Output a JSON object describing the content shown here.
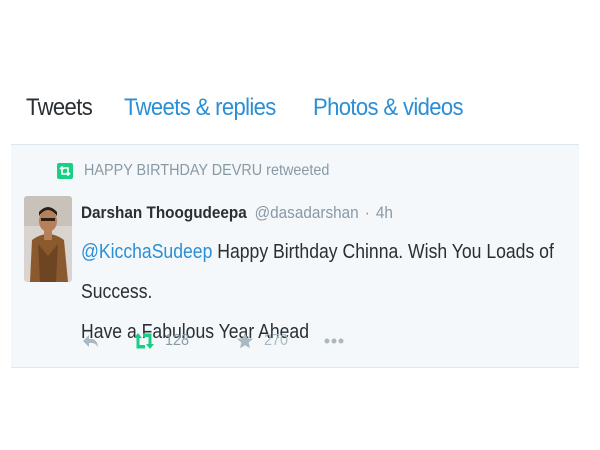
{
  "tabs": [
    {
      "label": "Tweets",
      "active": true
    },
    {
      "label": "Tweets & replies",
      "active": false
    },
    {
      "label": "Photos & videos",
      "active": false
    }
  ],
  "tweet": {
    "retweet_context": "HAPPY BIRTHDAY DEVRU retweeted",
    "fullname": "Darshan Thoogudeepa",
    "username": "@dasadarshan",
    "separator": "·",
    "time": "4h",
    "mention": "@KicchaSudeep",
    "text_line1": " Happy Birthday Chinna. Wish You Loads of Success.",
    "text_line2": "Have a Fabulous Year Ahead",
    "retweet_count": "128",
    "favorite_count": "270"
  },
  "icons": {
    "retweet_badge": "retweet-icon",
    "reply": "reply-icon",
    "retweet": "retweet-icon",
    "favorite": "star-icon",
    "more": "more-icon"
  },
  "colors": {
    "link": "#2a8fd6",
    "retweet_green": "#19cf86",
    "muted": "#8899a6",
    "action_gray": "#aab8c2",
    "card_bg": "#f5f8fa"
  }
}
